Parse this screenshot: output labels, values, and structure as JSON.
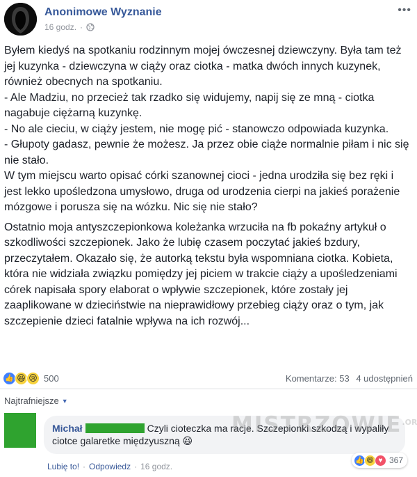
{
  "post": {
    "page_name": "Anonimowe Wyznanie",
    "time": "16 godz.",
    "privacy_icon": "globe-icon",
    "more_icon": "more-dots-icon",
    "paragraph1_lines": [
      "Byłem kiedyś na spotkaniu rodzinnym mojej ówczesnej dziewczyny. Była tam też jej kuzynka - dziewczyna w ciąży oraz ciotka - matka dwóch innych kuzynek, również obecnych na spotkaniu.",
      "- Ale Madziu, no przecież tak rzadko się widujemy, napij się ze mną - ciotka nagabuje ciężarną kuzynkę.",
      "- No ale cieciu, w ciąży jestem, nie mogę pić - stanowczo odpowiada kuzynka.",
      "- Głupoty gadasz, pewnie że możesz. Ja przez obie ciąże normalnie piłam i nic się nie stało.",
      "W tym miejscu warto opisać córki szanownej cioci - jedna urodziła się bez ręki i jest lekko upośledzona umysłowo, druga od urodzenia cierpi na jakieś porażenie mózgowe i porusza się na wózku. Nic się nie stało?"
    ],
    "paragraph2": "Ostatnio moja antyszczepionkowa koleżanka wrzuciła na fb pokaźny artykuł o szkodliwości szczepionek. Jako że lubię czasem poczytać jakieś bzdury, przeczytałem. Okazało się, że autorką tekstu była wspomniana ciotka. Kobieta, która nie widziała związku pomiędzy jej piciem w trakcie ciąży a upośledzeniami córek napisała spory elaborat o wpływie szczepionek, które zostały jej zaaplikowane w dzieciństwie na nieprawidłowy przebieg ciąży oraz o tym, jak szczepienie dzieci fatalnie wpływa na ich rozwój...",
    "reaction_count": "500",
    "comments": "Komentarze: 53",
    "shares": "4 udostępnień"
  },
  "comments_section": {
    "sort_label": "Najtrafniejsze",
    "comment": {
      "author": "Michał",
      "text": "Czyli cioteczka ma racje. Szczepionki szkodzą i wypaliły ciotce galaretke międzyuszną",
      "emoji": "😆",
      "like_label": "Lubię to!",
      "reply_label": "Odpowiedz",
      "time": "16 godz.",
      "reaction_count": "367"
    }
  },
  "watermark": {
    "text": "MISTRZOWIE",
    "suffix": ".ORG"
  },
  "colors": {
    "link_blue": "#365899",
    "meta_gray": "#90949c",
    "censor_green": "#2fa32f",
    "like_blue": "#4080ff"
  }
}
